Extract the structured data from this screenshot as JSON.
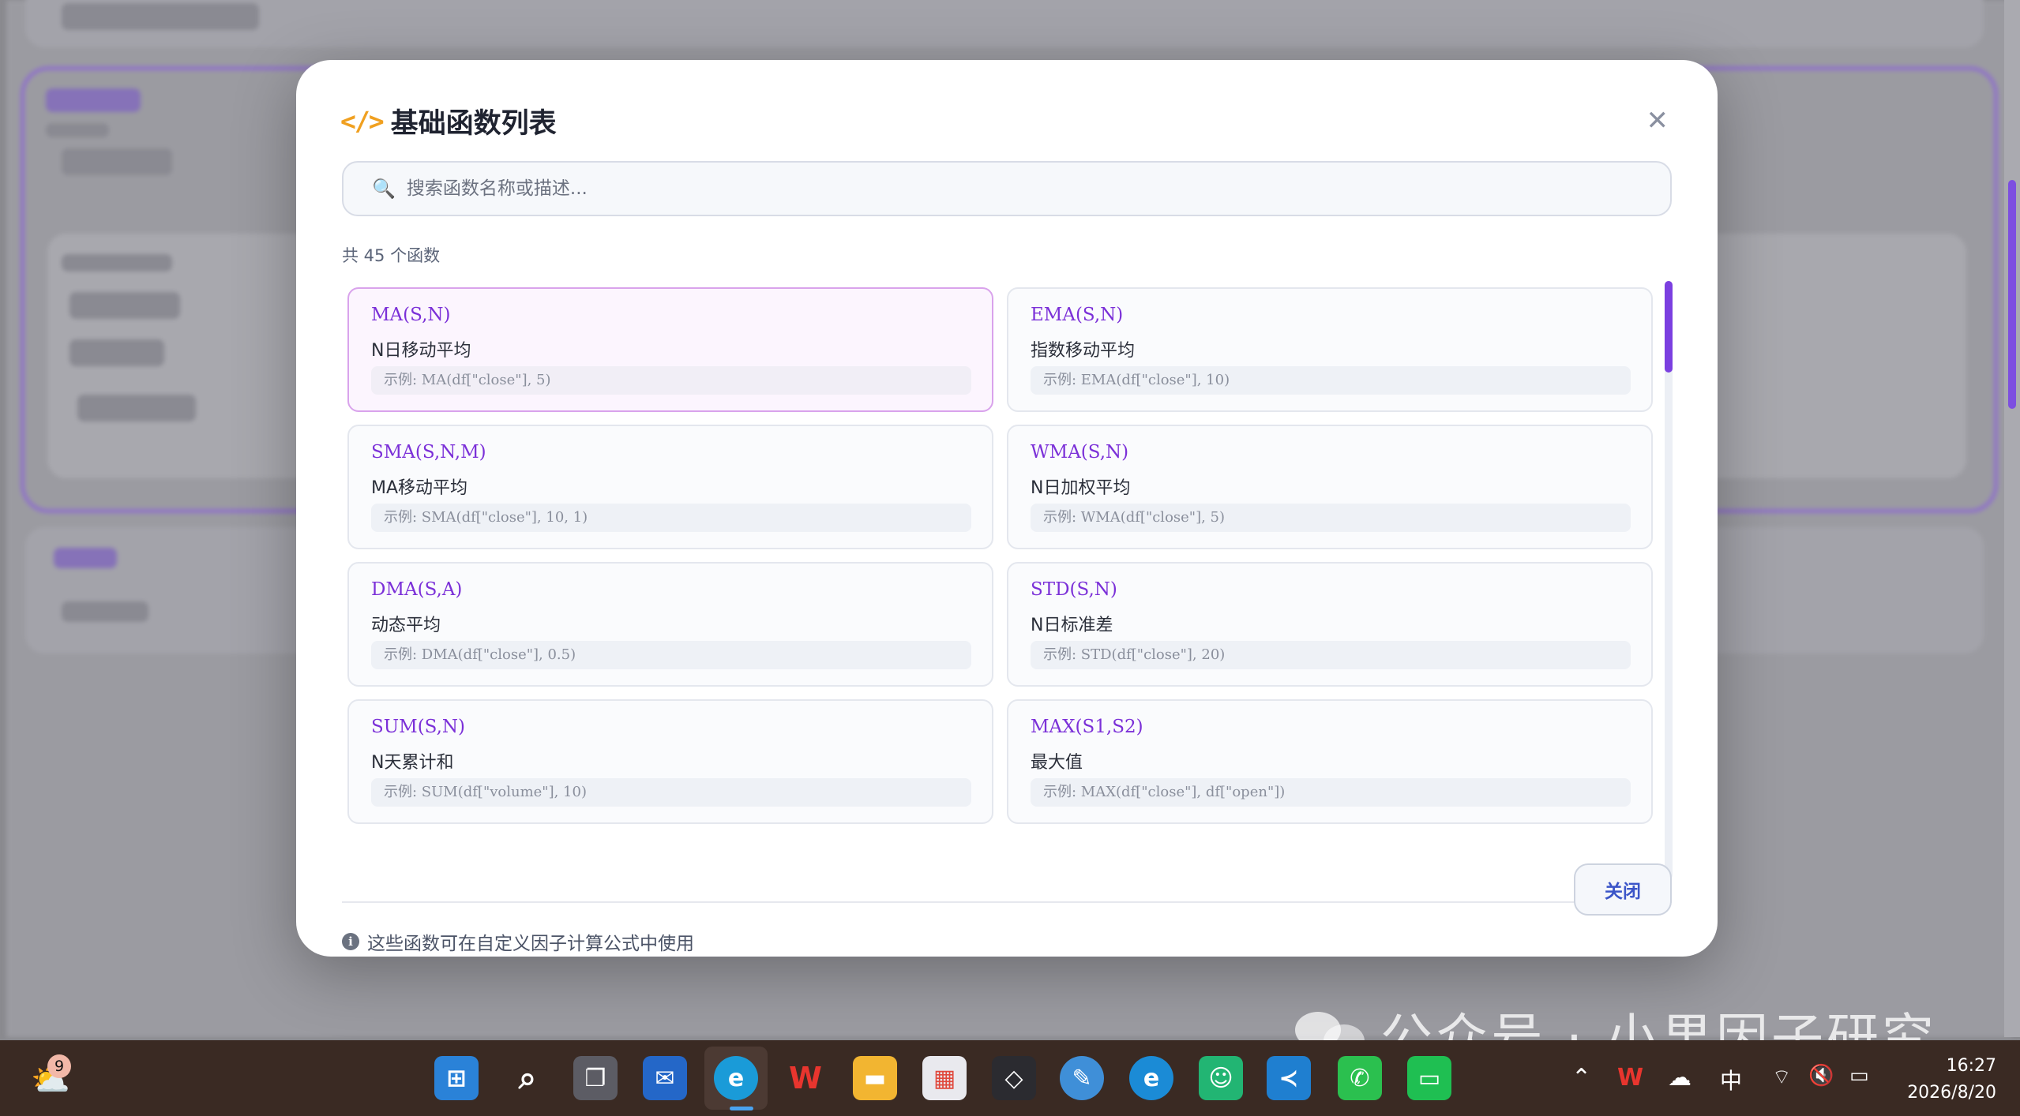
{
  "modal": {
    "title": "基础函数列表",
    "close_symbol": "✕",
    "search_placeholder": "搜索函数名称或描述...",
    "count_text": "共 45 个函数",
    "functions": [
      {
        "name": "MA(S,N)",
        "desc": "N日移动平均",
        "example": "示例: MA(df[\"close\"], 5)"
      },
      {
        "name": "EMA(S,N)",
        "desc": "指数移动平均",
        "example": "示例: EMA(df[\"close\"], 10)"
      },
      {
        "name": "SMA(S,N,M)",
        "desc": "MA移动平均",
        "example": "示例: SMA(df[\"close\"], 10, 1)"
      },
      {
        "name": "WMA(S,N)",
        "desc": "N日加权平均",
        "example": "示例: WMA(df[\"close\"], 5)"
      },
      {
        "name": "DMA(S,A)",
        "desc": "动态平均",
        "example": "示例: DMA(df[\"close\"], 0.5)"
      },
      {
        "name": "STD(S,N)",
        "desc": "N日标准差",
        "example": "示例: STD(df[\"close\"], 20)"
      },
      {
        "name": "SUM(S,N)",
        "desc": "N天累计和",
        "example": "示例: SUM(df[\"volume\"], 10)"
      },
      {
        "name": "MAX(S1,S2)",
        "desc": "最大值",
        "example": "示例: MAX(df[\"close\"], df[\"open\"])"
      }
    ],
    "footer_note": "这些函数可在自定义因子计算公式中使用",
    "close_button": "关闭"
  },
  "watermark": "公众号 · 小果因子研究",
  "taskbar": {
    "weather_badge": "9",
    "tray_ime": "中",
    "clock_time": "16:27",
    "clock_date": "2026/8/20"
  },
  "colors": {
    "accent": "#7b30d8",
    "selected_border": "#d9a3ec",
    "code_icon": "#f0a020",
    "close_button_text": "#3b55c8"
  }
}
